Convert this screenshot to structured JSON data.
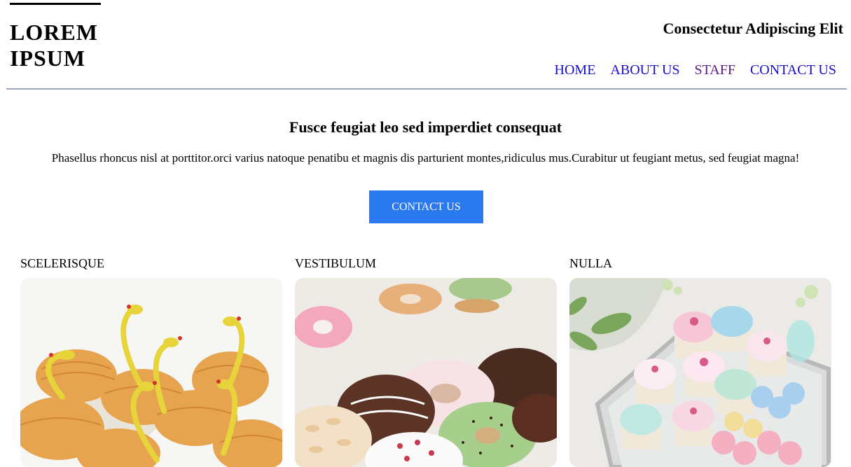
{
  "header": {
    "logo": "LOREM\nIPSUM",
    "tagline": "Consectetur Adipiscing Elit"
  },
  "nav": {
    "items": [
      {
        "label": "HOME",
        "color": "#1a0dcc"
      },
      {
        "label": "ABOUT US",
        "color": "#1a0dcc"
      },
      {
        "label": "STAFF",
        "color": "#5b1a86"
      },
      {
        "label": "CONTACT US",
        "color": "#1a0dcc"
      }
    ]
  },
  "hero": {
    "title": "Fusce feugiat leo sed imperdiet consequat",
    "text": "Phasellus rhoncus nisl at porttitor.orci varius natoque penatibu et magnis dis parturient montes,ridiculus mus.Curabitur ut feugiant metus, sed feugiat magna!",
    "button_label": "CONTACT US",
    "button_color": "#2a79ee"
  },
  "cards": [
    {
      "label": "SCELERISQUE"
    },
    {
      "label": "VESTIBULUM"
    },
    {
      "label": "NULLA"
    }
  ]
}
